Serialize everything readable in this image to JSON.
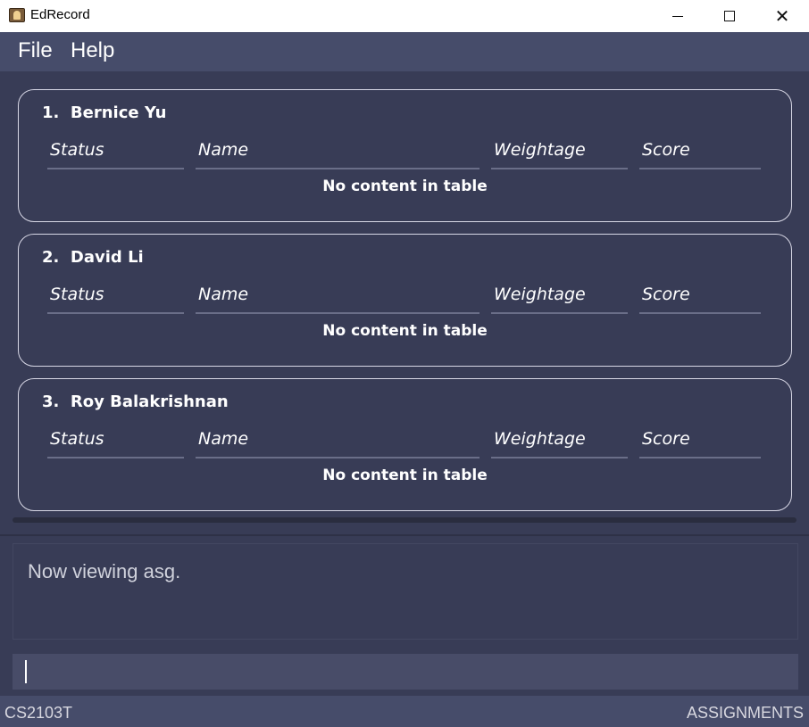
{
  "window": {
    "title": "EdRecord",
    "app_icon": "contact-book-icon",
    "minimize_icon": "minimize-icon",
    "maximize_icon": "maximize-icon",
    "close_icon": "close-icon",
    "close_glyph": "✕"
  },
  "menu": {
    "items": [
      {
        "label": "File"
      },
      {
        "label": "Help"
      }
    ]
  },
  "students": [
    {
      "index": "1.",
      "name": "Bernice Yu",
      "columns": [
        "Status",
        "Name",
        "Weightage",
        "Score"
      ],
      "empty_message": "No content in table"
    },
    {
      "index": "2.",
      "name": "David Li",
      "columns": [
        "Status",
        "Name",
        "Weightage",
        "Score"
      ],
      "empty_message": "No content in table"
    },
    {
      "index": "3.",
      "name": "Roy Balakrishnan",
      "columns": [
        "Status",
        "Name",
        "Weightage",
        "Score"
      ],
      "empty_message": "No content in table"
    }
  ],
  "result": {
    "message": "Now viewing asg."
  },
  "command": {
    "value": ""
  },
  "statusbar": {
    "module": "CS2103T",
    "view": "ASSIGNMENTS"
  },
  "colors": {
    "background": "#383c56",
    "menubar": "#464c6a",
    "card_border": "#d8d8e6",
    "command_box": "#484c68"
  }
}
